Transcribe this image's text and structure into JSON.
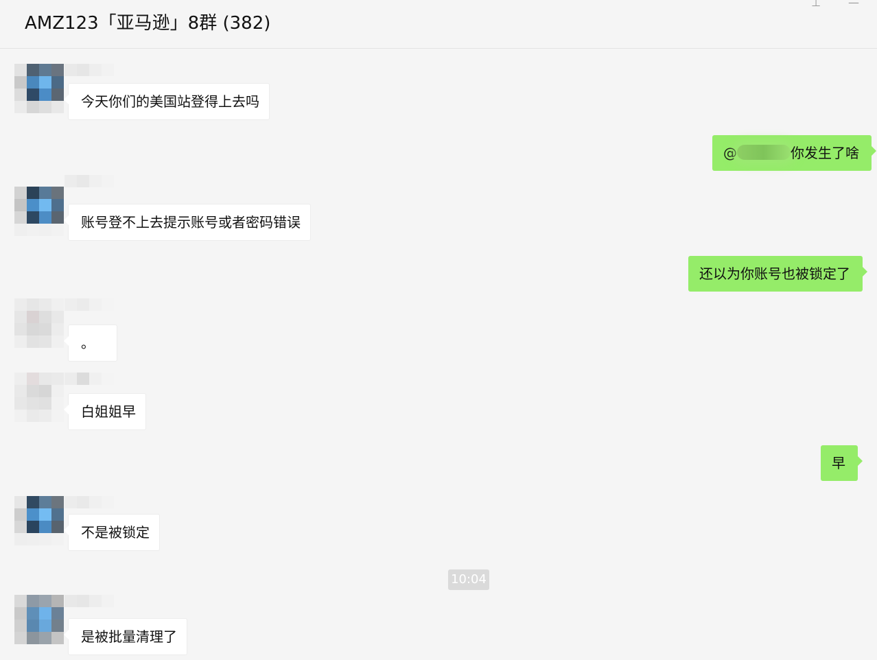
{
  "window": {
    "title": "AMZ123「亚马逊」8群 (382)",
    "controls": {
      "pin_icon": "pin-icon",
      "minimize_icon": "minimize-icon",
      "pin_glyph": "⊥",
      "minimize_glyph": "—"
    }
  },
  "colors": {
    "background": "#f5f5f5",
    "incoming_bubble": "#ffffff",
    "outgoing_bubble": "#95ec69",
    "time_badge": "#dadada"
  },
  "messages": [
    {
      "side": "left",
      "text": "今天你们的美国站登得上去吗",
      "avatar": "avatar-blue"
    },
    {
      "side": "right",
      "prefix": "@",
      "suffix": "你发生了啥",
      "mention_redacted": true
    },
    {
      "side": "left",
      "text": "账号登不上去提示账号或者密码错误",
      "avatar": "avatar-blue"
    },
    {
      "side": "right",
      "text": "还以为你账号也被锁定了"
    },
    {
      "side": "left",
      "text": "。",
      "avatar": "avatar-pale"
    },
    {
      "side": "left",
      "text": "白姐姐早",
      "avatar": "avatar-pale"
    },
    {
      "side": "right",
      "text": "早"
    },
    {
      "side": "left",
      "text": "不是被锁定",
      "avatar": "avatar-blue"
    },
    {
      "side": "left",
      "text": "是被批量清理了",
      "avatar": "avatar-gray-blue"
    }
  ],
  "time_separator": "10:04"
}
